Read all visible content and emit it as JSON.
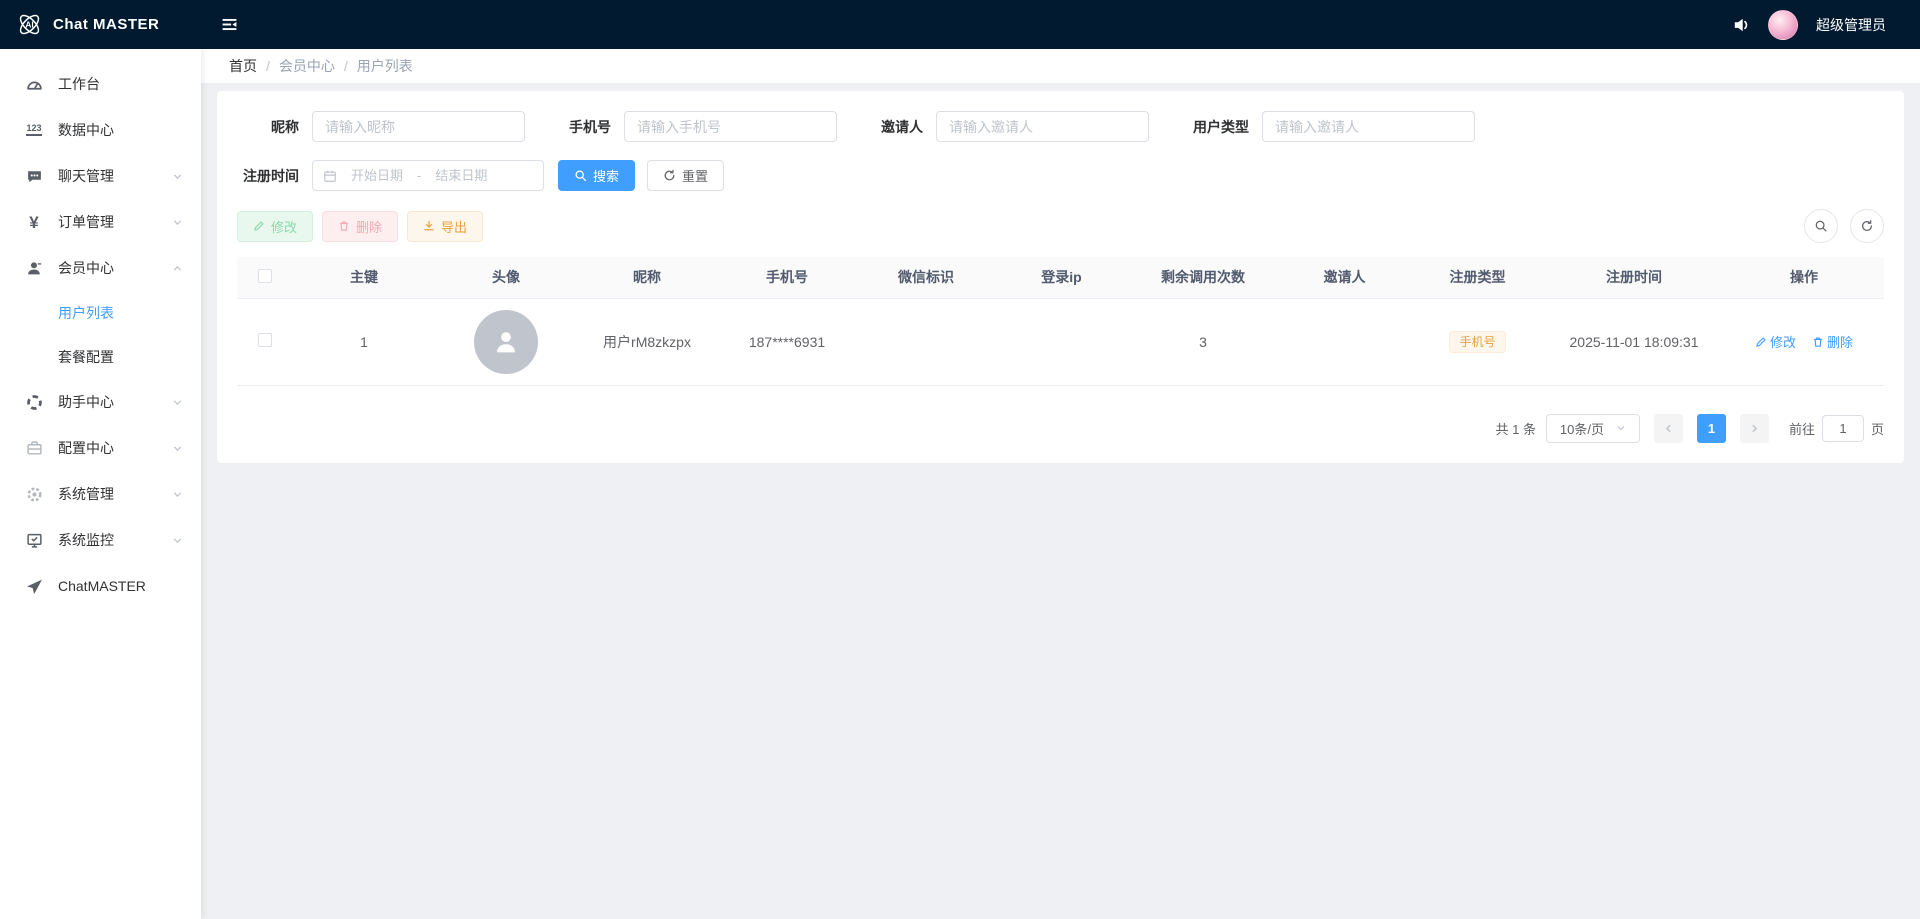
{
  "topbar": {
    "title": "Chat MASTER",
    "user_role": "超级管理员"
  },
  "breadcrumb": {
    "separator": "/",
    "items": [
      "首页",
      "会员中心",
      "用户列表"
    ]
  },
  "sidebar": {
    "items": [
      {
        "label": "工作台"
      },
      {
        "label": "数据中心"
      },
      {
        "label": "聊天管理"
      },
      {
        "label": "订单管理"
      },
      {
        "label": "会员中心"
      },
      {
        "label": "用户列表"
      },
      {
        "label": "套餐配置"
      },
      {
        "label": "助手中心"
      },
      {
        "label": "配置中心"
      },
      {
        "label": "系统管理"
      },
      {
        "label": "系统监控"
      },
      {
        "label": "ChatMASTER"
      }
    ]
  },
  "filters": {
    "nickname": {
      "label": "昵称",
      "placeholder": "请输入昵称",
      "value": ""
    },
    "phone": {
      "label": "手机号",
      "placeholder": "请输入手机号",
      "value": ""
    },
    "inviter": {
      "label": "邀请人",
      "placeholder": "请输入邀请人",
      "value": ""
    },
    "user_type": {
      "label": "用户类型",
      "placeholder": "请输入邀请人",
      "value": ""
    },
    "register_time": {
      "label": "注册时间",
      "start_placeholder": "开始日期",
      "separator": "-",
      "end_placeholder": "结束日期"
    },
    "search_label": "搜索",
    "reset_label": "重置"
  },
  "toolbar": {
    "edit_label": "修改",
    "delete_label": "删除",
    "export_label": "导出"
  },
  "table": {
    "columns": [
      "主键",
      "头像",
      "昵称",
      "手机号",
      "微信标识",
      "登录ip",
      "剩余调用次数",
      "邀请人",
      "注册类型",
      "注册时间",
      "操作"
    ],
    "rows": [
      {
        "id": "1",
        "nickname": "用户rM8zkzpx",
        "phone": "187****6931",
        "wechat_id": "",
        "login_ip": "",
        "remaining_calls": "3",
        "inviter": "",
        "register_type": "手机号",
        "register_time": "2025-11-01 18:09:31",
        "edit_label": "修改",
        "delete_label": "删除"
      }
    ]
  },
  "pagination": {
    "total_text": "共 1 条",
    "page_size": "10条/页",
    "current_page": "1",
    "goto_prefix": "前往",
    "goto_value": "1",
    "goto_suffix": "页"
  },
  "colors": {
    "primary": "#409eff",
    "topbar_bg": "#021a30",
    "warning": "#e6a23c",
    "page_bg": "#eef0f4",
    "tag_warning_bg": "#fdf6ec"
  }
}
